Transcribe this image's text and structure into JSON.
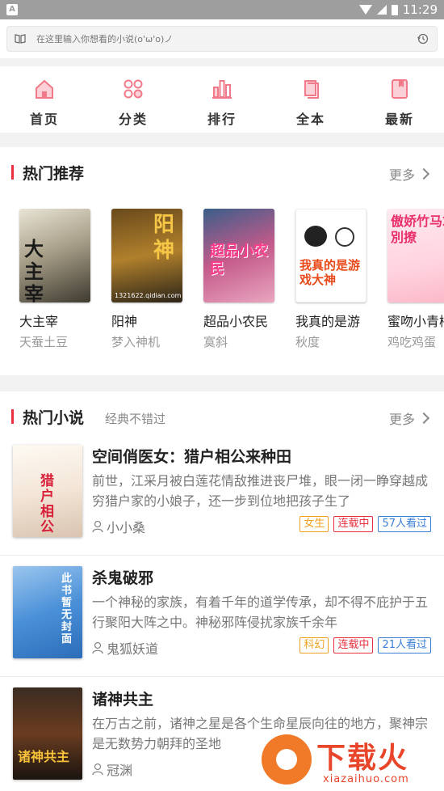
{
  "status_bar": {
    "left_icon": "A",
    "time": "11:29"
  },
  "search": {
    "placeholder": "在这里输入你想看的小说(o'ω'o)ノ"
  },
  "nav": [
    {
      "label": "首页",
      "icon": "home-icon"
    },
    {
      "label": "分类",
      "icon": "category-icon"
    },
    {
      "label": "排行",
      "icon": "rank-icon"
    },
    {
      "label": "全本",
      "icon": "complete-book-icon"
    },
    {
      "label": "最新",
      "icon": "newest-icon"
    }
  ],
  "hot_recommend": {
    "title": "热门推荐",
    "more": "更多",
    "books": [
      {
        "name": "大主宰",
        "author": "天蚕土豆",
        "cover_text": "大主宰"
      },
      {
        "name": "阳神",
        "author": "梦入神机",
        "cover_text": "阳神",
        "cover_sub": "1321622.qidian.com"
      },
      {
        "name": "超品小农民",
        "author": "寞斜",
        "cover_text": "超品小农民"
      },
      {
        "name": "我真的是游",
        "author": "秋度",
        "cover_text": "我真的是游戏大神"
      },
      {
        "name": "蜜吻小青梅",
        "author": "鸡吃鸡蛋",
        "cover_text": "傲娇竹马求別撩"
      }
    ]
  },
  "hot_novels": {
    "title": "热门小说",
    "subtitle": "经典不错过",
    "more": "更多",
    "items": [
      {
        "title": "空间俏医女：猎户相公来种田",
        "desc": "前世，江采月被白莲花情敌推进丧尸堆，眼一闭一睁穿越成穷猎户家的小娘子，还一步到位地把孩子生了",
        "author": "小小桑",
        "tags": [
          "女生",
          "连载中",
          "57人看过"
        ],
        "cover_text": "猎户相公"
      },
      {
        "title": "杀鬼破邪",
        "desc": "一个神秘的家族，有着千年的道学传承，却不得不庇护于五行聚阳大阵之中。神秘邪阵侵扰家族千余年",
        "author": "鬼狐妖道",
        "tags": [
          "科幻",
          "连载中",
          "21人看过"
        ],
        "cover_text": "此书暂无封面"
      },
      {
        "title": "诸神共主",
        "desc": "在万古之前，诸神之星是各个生命星辰向往的地方，聚神宗是无数势力朝拜的圣地",
        "author": "冠渊",
        "tags": [],
        "cover_text": "诸神共主"
      }
    ]
  },
  "watermark": {
    "text": "下载火",
    "url": "xiazaihuo.com"
  },
  "colors": {
    "accent": "#e8303f",
    "nav_icon": "#f07a8a",
    "tag_category": "#f0a020",
    "tag_views": "#3a7fd5"
  }
}
